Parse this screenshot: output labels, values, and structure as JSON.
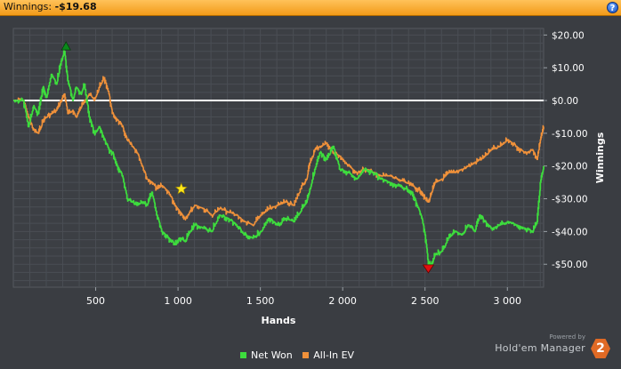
{
  "header": {
    "label": "Winnings:",
    "value": "-$19.68",
    "help_label": "?"
  },
  "chart_data": {
    "type": "line",
    "xlabel": "Hands",
    "ylabel": "Winnings",
    "xlim": [
      0,
      3220
    ],
    "ylim": [
      -57,
      22
    ],
    "x_ticks": [
      {
        "value": 500,
        "label": "500"
      },
      {
        "value": 1000,
        "label": "1 000"
      },
      {
        "value": 1500,
        "label": "1 500"
      },
      {
        "value": 2000,
        "label": "2 000"
      },
      {
        "value": 2500,
        "label": "2 500"
      },
      {
        "value": 3000,
        "label": "3 000"
      }
    ],
    "y_ticks": [
      {
        "value": 20,
        "label": "$20.00"
      },
      {
        "value": 10,
        "label": "$10.00"
      },
      {
        "value": 0,
        "label": "$0.00"
      },
      {
        "value": -10,
        "label": "-$10.00"
      },
      {
        "value": -20,
        "label": "-$20.00"
      },
      {
        "value": -30,
        "label": "-$30.00"
      },
      {
        "value": -40,
        "label": "-$40.00"
      },
      {
        "value": -50,
        "label": "-$50.00"
      }
    ],
    "grid": true,
    "zero_line": true,
    "legend_position": "bottom-center",
    "colors": {
      "net_won": "#3ddc3d",
      "all_in_ev": "#f0913a",
      "zero_line": "#ffffff"
    },
    "series": [
      {
        "name": "Net Won",
        "x": [
          0,
          60,
          90,
          120,
          150,
          180,
          200,
          230,
          260,
          290,
          310,
          330,
          360,
          380,
          410,
          430,
          460,
          490,
          520,
          550,
          580,
          600,
          630,
          660,
          690,
          720,
          750,
          780,
          810,
          840,
          870,
          900,
          940,
          980,
          1010,
          1040,
          1070,
          1100,
          1150,
          1200,
          1250,
          1300,
          1350,
          1400,
          1450,
          1500,
          1550,
          1600,
          1650,
          1700,
          1750,
          1780,
          1800,
          1830,
          1860,
          1900,
          1940,
          1980,
          2030,
          2080,
          2130,
          2180,
          2230,
          2280,
          2330,
          2380,
          2420,
          2450,
          2480,
          2500,
          2520,
          2540,
          2560,
          2600,
          2640,
          2680,
          2720,
          2760,
          2800,
          2830,
          2860,
          2900,
          2950,
          3000,
          3050,
          3100,
          3150,
          3180,
          3200,
          3220
        ],
        "y": [
          0,
          0,
          -8,
          -2,
          -4,
          4,
          1,
          8,
          5,
          12,
          15,
          6,
          0,
          4,
          2,
          5,
          -5,
          -10,
          -8,
          -12,
          -15,
          -16,
          -20,
          -23,
          -30,
          -31,
          -32,
          -31,
          -32,
          -28,
          -35,
          -40,
          -42,
          -44,
          -42,
          -43,
          -40,
          -38,
          -39,
          -40,
          -35,
          -36,
          -38,
          -41,
          -42,
          -40,
          -36,
          -38,
          -36,
          -37,
          -33,
          -31,
          -27,
          -21,
          -16,
          -18,
          -14,
          -21,
          -22,
          -24,
          -21,
          -22,
          -24,
          -25,
          -26,
          -27,
          -28,
          -32,
          -36,
          -41,
          -50,
          -50,
          -47,
          -46,
          -42,
          -40,
          -41,
          -38,
          -40,
          -35,
          -37,
          -39,
          -38,
          -37,
          -38,
          -39,
          -40,
          -37,
          -25,
          -20
        ]
      },
      {
        "name": "All-In EV",
        "x": [
          0,
          60,
          90,
          120,
          150,
          180,
          200,
          230,
          260,
          290,
          310,
          330,
          360,
          380,
          410,
          430,
          460,
          490,
          520,
          550,
          580,
          600,
          630,
          660,
          690,
          720,
          750,
          780,
          810,
          840,
          870,
          900,
          940,
          980,
          1010,
          1040,
          1070,
          1100,
          1150,
          1200,
          1250,
          1300,
          1350,
          1400,
          1450,
          1500,
          1550,
          1600,
          1650,
          1700,
          1750,
          1780,
          1800,
          1830,
          1860,
          1900,
          1940,
          1980,
          2030,
          2080,
          2130,
          2180,
          2230,
          2280,
          2330,
          2380,
          2420,
          2450,
          2480,
          2500,
          2520,
          2540,
          2560,
          2600,
          2640,
          2680,
          2720,
          2760,
          2800,
          2830,
          2860,
          2900,
          2950,
          3000,
          3050,
          3100,
          3150,
          3180,
          3200,
          3220
        ],
        "y": [
          0,
          0,
          -5,
          -9,
          -10,
          -6,
          -5,
          -4,
          -3,
          0,
          2,
          -4,
          -3,
          -5,
          -2,
          0,
          2,
          0,
          4,
          7,
          2,
          -4,
          -6,
          -8,
          -12,
          -14,
          -16,
          -20,
          -24,
          -25,
          -27,
          -26,
          -28,
          -32,
          -34,
          -36,
          -34,
          -32,
          -33,
          -35,
          -33,
          -34,
          -35,
          -37,
          -38,
          -35,
          -33,
          -32,
          -31,
          -32,
          -26,
          -24,
          -19,
          -15,
          -14,
          -13,
          -16,
          -17,
          -20,
          -22,
          -21,
          -22,
          -23,
          -23,
          -24,
          -25,
          -26,
          -27,
          -28,
          -30,
          -31,
          -28,
          -25,
          -24,
          -22,
          -22,
          -21,
          -20,
          -19,
          -18,
          -17,
          -15,
          -14,
          -12,
          -14,
          -16,
          -15,
          -18,
          -12,
          -8
        ]
      }
    ],
    "markers": [
      {
        "kind": "max",
        "x": 320,
        "y": 16,
        "color": "#0a8a1a"
      },
      {
        "kind": "min",
        "x": 2520,
        "y": -51,
        "color": "#e01010"
      },
      {
        "kind": "star",
        "x": 1020,
        "y": -27,
        "color": "#ffe81a"
      }
    ]
  },
  "legend": {
    "items": [
      {
        "label": "Net Won",
        "color": "#3ddc3d"
      },
      {
        "label": "All-In EV",
        "color": "#f0913a"
      }
    ]
  },
  "branding": {
    "powered": "Powered by",
    "product": "Hold'em Manager",
    "badge": "2"
  }
}
